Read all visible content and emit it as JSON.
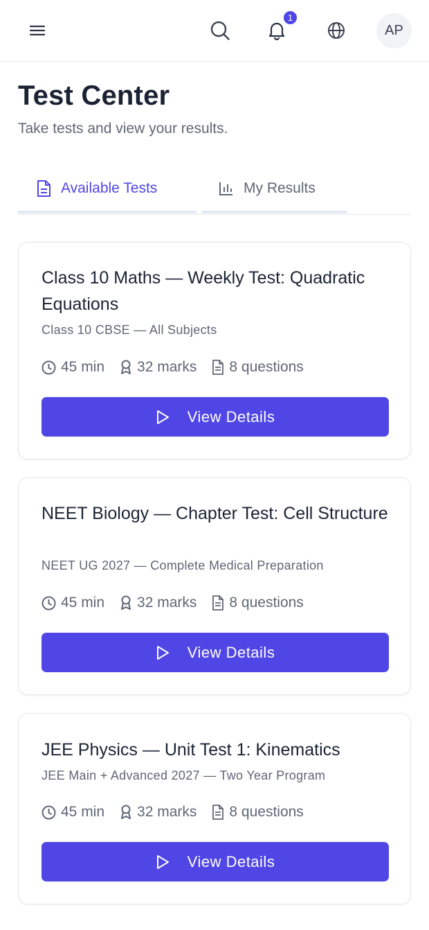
{
  "header": {
    "notification_count": "1",
    "avatar_initials": "AP",
    "icons": [
      "menu-icon",
      "search-icon",
      "bell-icon",
      "globe-icon"
    ]
  },
  "page": {
    "title": "Test Center",
    "subtitle": "Take tests and view your results."
  },
  "tabs": [
    {
      "label": "Available Tests",
      "icon": "document-icon",
      "active": true
    },
    {
      "label": "My Results",
      "icon": "bar-chart-icon",
      "active": false
    }
  ],
  "tests": [
    {
      "title": "Class 10 Maths — Weekly Test: Quadratic Equations",
      "course": "Class 10 CBSE — All Subjects",
      "duration": "45 min",
      "marks": "32 marks",
      "questions": "8 questions",
      "button_label": "View Details"
    },
    {
      "title": "NEET Biology — Chapter Test: Cell Structure",
      "course": "NEET UG 2027 — Complete Medical Preparation",
      "duration": "45 min",
      "marks": "32 marks",
      "questions": "8 questions",
      "button_label": "View Details"
    },
    {
      "title": "JEE Physics — Unit Test 1: Kinematics",
      "course": "JEE Main + Advanced 2027 — Two Year Program",
      "duration": "45 min",
      "marks": "32 marks",
      "questions": "8 questions",
      "button_label": "View Details"
    }
  ],
  "colors": {
    "accent": "#4f46e5",
    "title_text": "#1a2234",
    "muted_text": "#5f6675",
    "border": "#e5e7eb"
  }
}
